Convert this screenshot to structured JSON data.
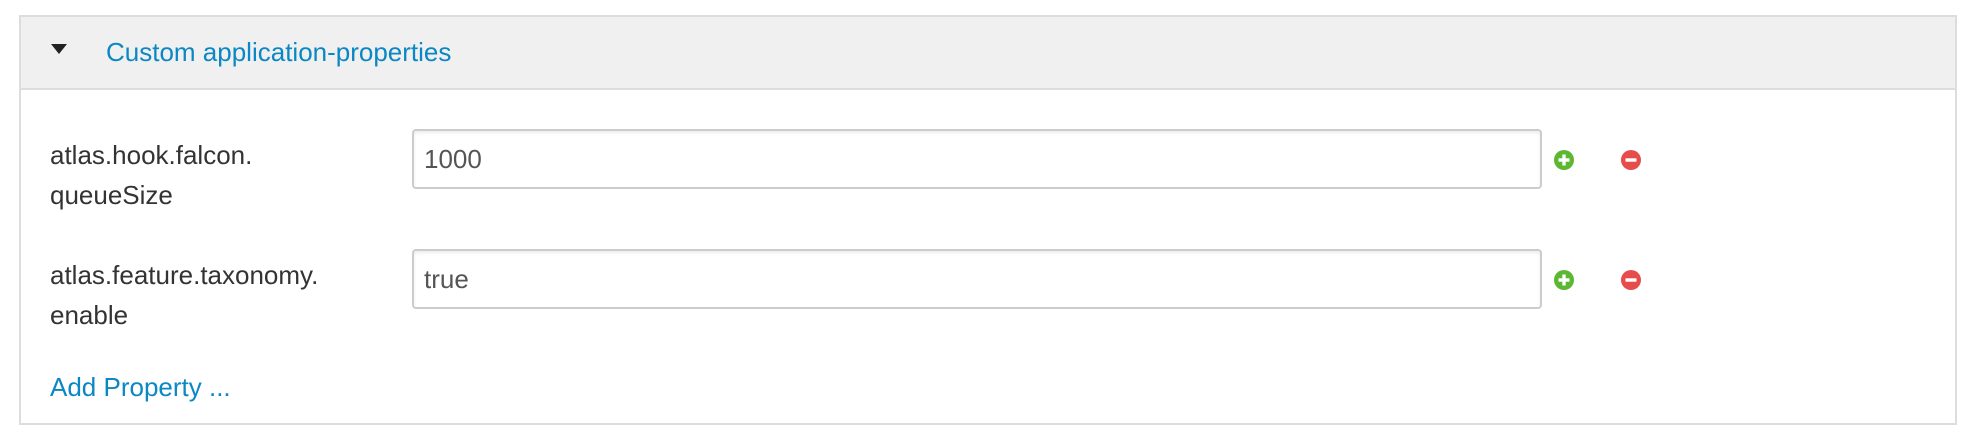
{
  "section": {
    "title": "Custom application-properties",
    "toggle_icon": "caret-down-icon"
  },
  "properties": [
    {
      "label_line1": "atlas.hook.falcon.",
      "label_line2": "queueSize",
      "value": "1000"
    },
    {
      "label_line1": "atlas.feature.taxonomy.",
      "label_line2": "enable",
      "value": "true"
    }
  ],
  "actions": {
    "add_property_label": "Add Property ...",
    "add_icon": "plus-circle-icon",
    "remove_icon": "minus-circle-icon"
  },
  "colors": {
    "link": "#0a87c4",
    "add": "#5cb832",
    "remove": "#e74c4c",
    "header_bg": "#f0f0f0",
    "border": "#dddddd"
  }
}
